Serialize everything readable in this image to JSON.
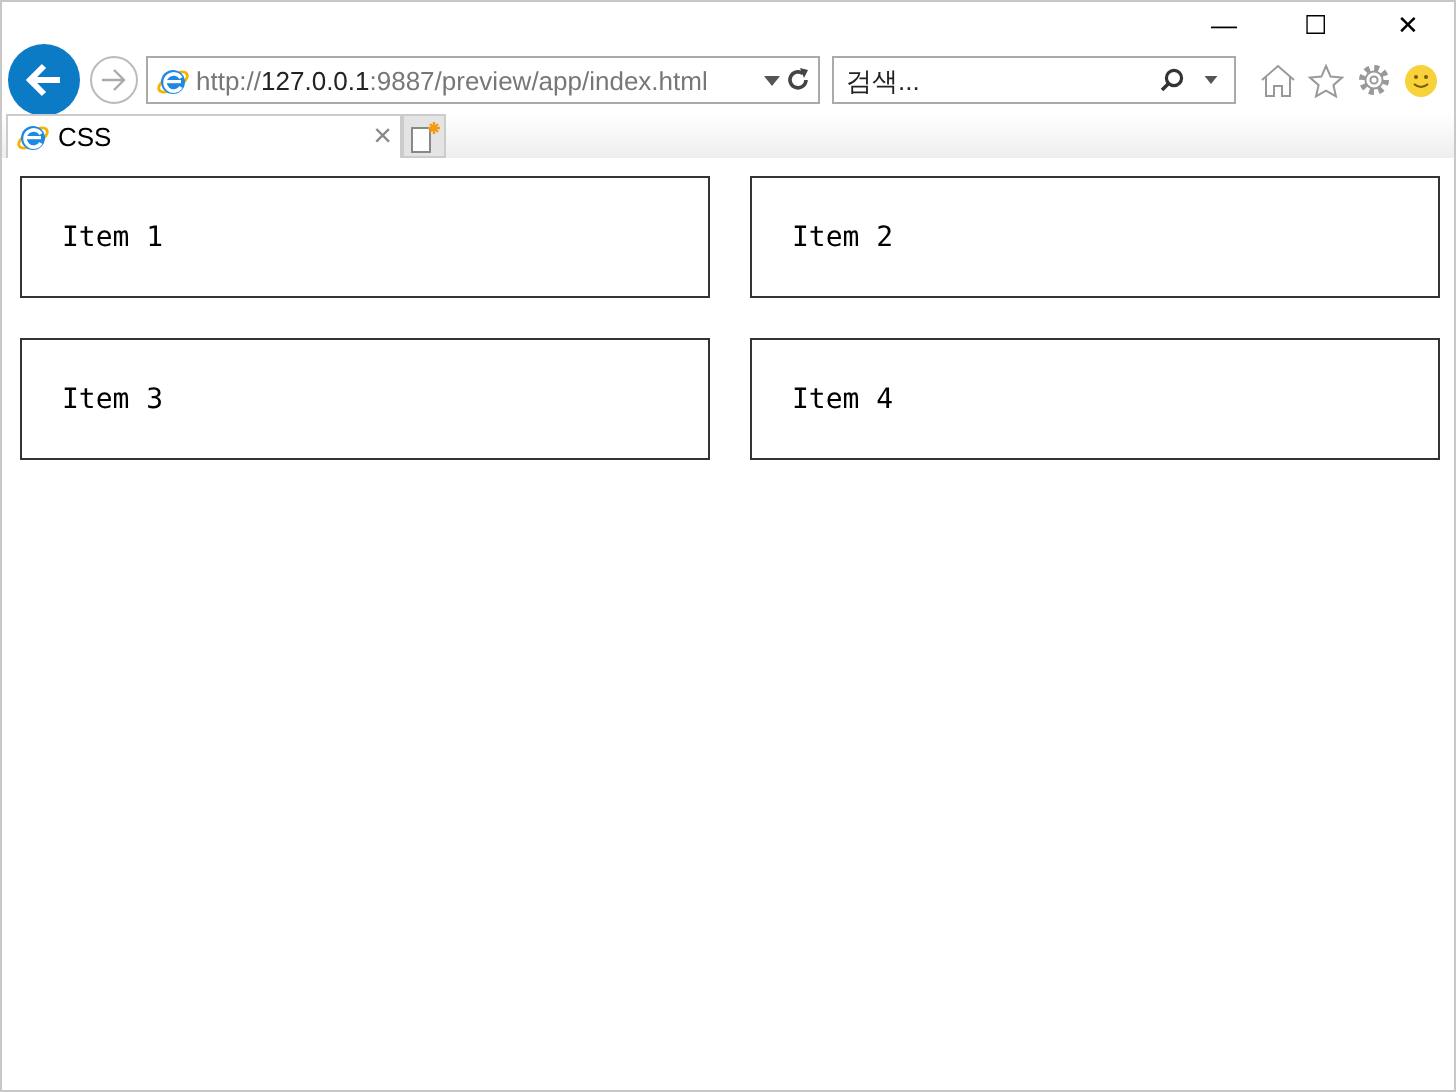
{
  "window": {
    "controls": [
      "—",
      "☐",
      "✕"
    ]
  },
  "address_bar": {
    "scheme": "http://",
    "host": "127.0.0.1",
    "path": ":9887/preview/app/index.html"
  },
  "search": {
    "placeholder": "검색..."
  },
  "tabs": [
    {
      "label": "CSS",
      "selected": true,
      "close": "×"
    }
  ],
  "items": [
    {
      "label": "Item 1"
    },
    {
      "label": "Item 2"
    },
    {
      "label": "Item 3"
    },
    {
      "label": "Item 4"
    }
  ]
}
